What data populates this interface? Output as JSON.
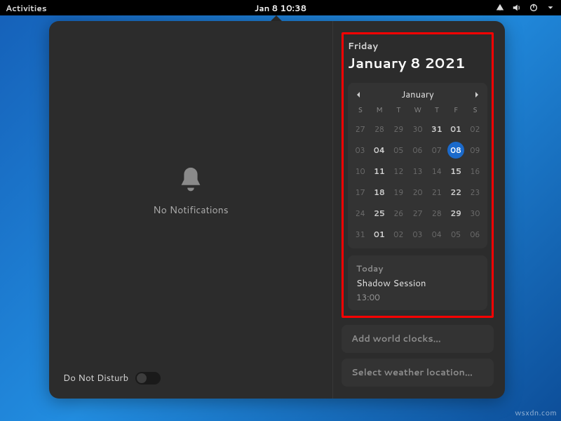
{
  "topbar": {
    "activities": "Activities",
    "clock": "Jan 8  10:38"
  },
  "notifications": {
    "empty_label": "No Notifications",
    "dnd_label": "Do Not Disturb"
  },
  "date_header": {
    "weekday": "Friday",
    "fulldate": "January 8 2021"
  },
  "calendar": {
    "month_label": "January",
    "dow": [
      "S",
      "M",
      "T",
      "W",
      "T",
      "F",
      "S"
    ],
    "weeks": [
      [
        {
          "d": "27",
          "m": "out"
        },
        {
          "d": "28",
          "m": "out"
        },
        {
          "d": "29",
          "m": "out"
        },
        {
          "d": "30",
          "m": "out"
        },
        {
          "d": "31",
          "m": "in"
        },
        {
          "d": "01",
          "m": "in"
        },
        {
          "d": "02",
          "m": "out"
        }
      ],
      [
        {
          "d": "03",
          "m": "out"
        },
        {
          "d": "04",
          "m": "in"
        },
        {
          "d": "05",
          "m": "out"
        },
        {
          "d": "06",
          "m": "out"
        },
        {
          "d": "07",
          "m": "out"
        },
        {
          "d": "08",
          "m": "selected"
        },
        {
          "d": "09",
          "m": "out"
        }
      ],
      [
        {
          "d": "10",
          "m": "out"
        },
        {
          "d": "11",
          "m": "in"
        },
        {
          "d": "12",
          "m": "out"
        },
        {
          "d": "13",
          "m": "out"
        },
        {
          "d": "14",
          "m": "out"
        },
        {
          "d": "15",
          "m": "in"
        },
        {
          "d": "16",
          "m": "out"
        }
      ],
      [
        {
          "d": "17",
          "m": "out"
        },
        {
          "d": "18",
          "m": "in"
        },
        {
          "d": "19",
          "m": "out"
        },
        {
          "d": "20",
          "m": "out"
        },
        {
          "d": "21",
          "m": "out"
        },
        {
          "d": "22",
          "m": "in"
        },
        {
          "d": "23",
          "m": "out"
        }
      ],
      [
        {
          "d": "24",
          "m": "out"
        },
        {
          "d": "25",
          "m": "in"
        },
        {
          "d": "26",
          "m": "out"
        },
        {
          "d": "27",
          "m": "out"
        },
        {
          "d": "28",
          "m": "out"
        },
        {
          "d": "29",
          "m": "in"
        },
        {
          "d": "30",
          "m": "out"
        }
      ],
      [
        {
          "d": "31",
          "m": "out"
        },
        {
          "d": "01",
          "m": "in"
        },
        {
          "d": "02",
          "m": "out"
        },
        {
          "d": "03",
          "m": "out"
        },
        {
          "d": "04",
          "m": "out"
        },
        {
          "d": "05",
          "m": "out"
        },
        {
          "d": "06",
          "m": "out"
        }
      ]
    ]
  },
  "events": {
    "today_label": "Today",
    "items": [
      {
        "title": "Shadow Session",
        "time": "13:00"
      }
    ]
  },
  "world_clocks_button": "Add world clocks…",
  "weather_button": "Select weather location…",
  "watermark": "wsxdn.com"
}
